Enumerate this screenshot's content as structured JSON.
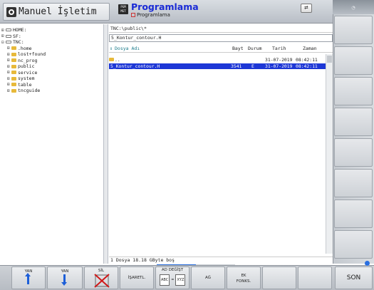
{
  "header": {
    "mode_title": "Manuel İşletim",
    "program_title": "Programlama",
    "program_sub": "Programlama",
    "program_icon_text": "PGM MGT"
  },
  "tree": [
    {
      "label": "HOME:",
      "type": "drive",
      "exp": "⊞"
    },
    {
      "label": "SF:",
      "type": "drive",
      "exp": "⊞"
    },
    {
      "label": "TNC:",
      "type": "drive",
      "exp": "⊟"
    },
    {
      "label": ".home",
      "type": "folder",
      "exp": "⊞"
    },
    {
      "label": "lost+found",
      "type": "folder",
      "exp": "⊞"
    },
    {
      "label": "nc_prog",
      "type": "folder",
      "exp": "⊞"
    },
    {
      "label": "public",
      "type": "folder",
      "exp": "⊞",
      "active": true
    },
    {
      "label": "service",
      "type": "folder",
      "exp": "⊞"
    },
    {
      "label": "system",
      "type": "folder",
      "exp": "⊞"
    },
    {
      "label": "table",
      "type": "folder",
      "exp": "⊞"
    },
    {
      "label": "tncguide",
      "type": "folder",
      "exp": "⊞"
    }
  ],
  "path": "TNC:\\public\\*",
  "file_field": "5_Kontur_contour.H",
  "columns": {
    "name": "Dosya Adı",
    "size": "Bayt",
    "status": "Durum",
    "date": "Tarih",
    "time": "Zaman",
    "sort_icon": "⇕"
  },
  "files": [
    {
      "name": "..",
      "size": "",
      "status": "",
      "date": "31-07-2019",
      "time": "08:42:11",
      "selected": false,
      "folder": true
    },
    {
      "name": "5_Kontur_contour.H",
      "size": "3541",
      "status": "E",
      "date": "31-07-2019",
      "time": "08:42:11",
      "selected": true,
      "folder": false
    }
  ],
  "status_bar": "1   Dosya  18.18 GByte boş",
  "softkeys": {
    "yan_up": "YAN",
    "yan_down": "YAN",
    "sil": "SİL",
    "isaretl": "İŞARETL.",
    "ad_degist": "AD DEĞİŞT",
    "ad_degist_from": "ABC",
    "ad_degist_to": "XYZ",
    "ag": "AĞ",
    "ek_fonks": "EK\nFONKS.",
    "son": "SON"
  }
}
